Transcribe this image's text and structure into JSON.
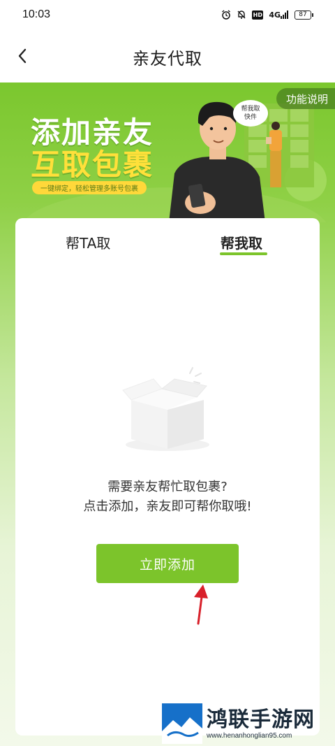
{
  "status_bar": {
    "time": "10:03",
    "icons": [
      "alarm-icon",
      "mute-icon",
      "hd-icon",
      "signal-4g-icon",
      "battery-icon"
    ],
    "hd_label": "HD",
    "signal_label": "4G",
    "battery": "87"
  },
  "nav": {
    "title": "亲友代取",
    "back_icon": "chevron-left-icon"
  },
  "banner": {
    "title_line1": "添加亲友",
    "title_line2": "互取包裹",
    "subtitle": "一键绑定，轻松管理多账号包裹",
    "speech_line1": "帮我取",
    "speech_line2": "快件",
    "function_button": "功能说明"
  },
  "tabs": [
    {
      "label": "帮TA取",
      "active": false
    },
    {
      "label": "帮我取",
      "active": true
    }
  ],
  "empty_state": {
    "icon": "empty-box-icon",
    "line1": "需要亲友帮忙取包裹?",
    "line2": "点击添加，亲友即可帮你取哦!"
  },
  "primary_button": {
    "label": "立即添加"
  },
  "watermark": {
    "name": "鸿联手游网",
    "url": "www.henanhonglian95.com"
  },
  "colors": {
    "accent_green": "#7cc42b",
    "banner_yellow": "#ffe03a",
    "annotation_red": "#d8202a"
  }
}
